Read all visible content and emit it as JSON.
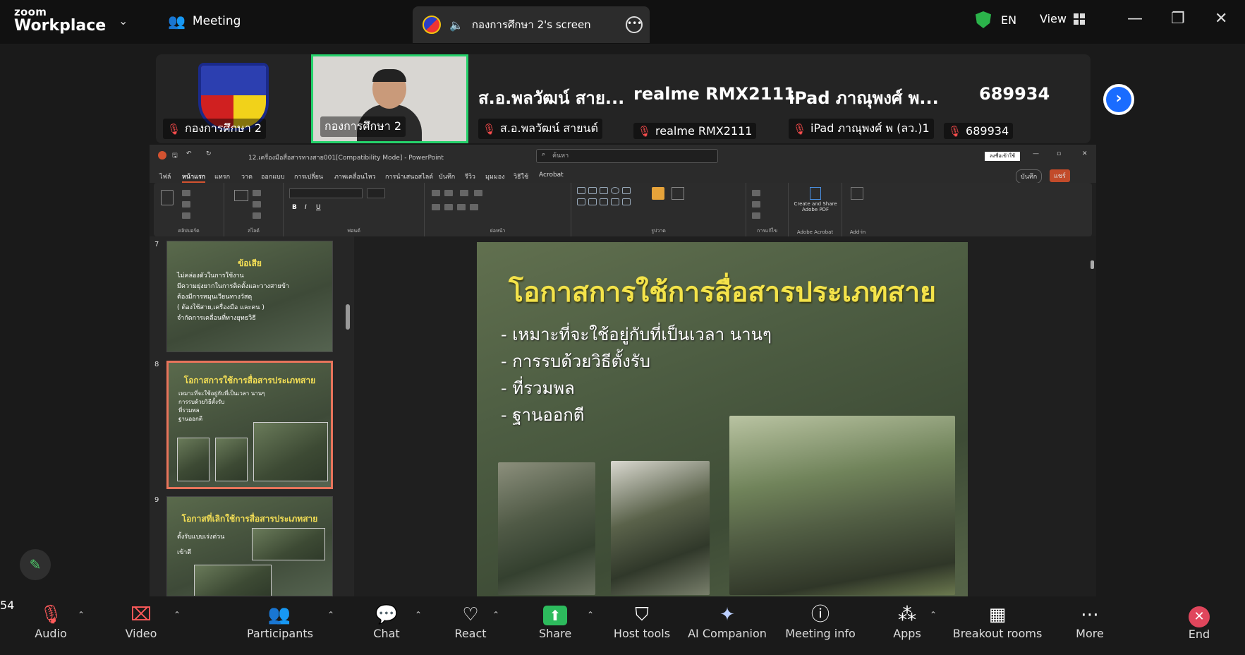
{
  "app": {
    "brand_top": "zoom",
    "brand_bottom": "Workplace"
  },
  "header": {
    "meeting_label": "Meeting",
    "screen_tab_label": "กองการศึกษา 2's screen",
    "language": "EN",
    "view_label": "View"
  },
  "participants": [
    {
      "name": "กองการศึกษา 2",
      "display": "",
      "muted": true
    },
    {
      "name": "กองการศึกษา 2",
      "display": "",
      "muted": false
    },
    {
      "name": "ส.อ.พลวัฒน์ สายนต์",
      "display": "ส.อ.พลวัฒน์ สาย...",
      "muted": true
    },
    {
      "name": "realme RMX2111",
      "display": "realme RMX2111",
      "muted": true
    },
    {
      "name": "iPad ภาณุพงศ์ พ (ลว.)1",
      "display": "iPad ภาณุพงศ์ พ...",
      "muted": true
    },
    {
      "name": "689934",
      "display": "689934",
      "muted": true
    }
  ],
  "powerpoint": {
    "title": "12.เครื่องมือสื่อสารทางสาย001[Compatibility Mode] - PowerPoint",
    "search_placeholder": "ค้นหา",
    "account_btn": "ลงชื่อเข้าใช้",
    "tabs": [
      "ไฟล์",
      "หน้าแรก",
      "แทรก",
      "วาด",
      "ออกแบบ",
      "การเปลี่ยน",
      "ภาพเคลื่อนไหว",
      "การนำเสนอสไลด์",
      "บันทึก",
      "รีวิว",
      "มุมมอง",
      "วิธีใช้",
      "Acrobat"
    ],
    "ribbon": {
      "clipboard": "คลิปบอร์ด",
      "slides": "สไลด์",
      "font": "ฟอนต์",
      "paragraph": "ย่อหน้า",
      "drawing": "รูปวาด",
      "editing": "การแก้ไข",
      "acrobat_btn": "Create and Share Adobe PDF",
      "acrobat": "Adobe Acrobat",
      "addin": "Add-in",
      "record_btn": "บันทึก",
      "share_btn": "แชร์"
    },
    "thumbnails": [
      {
        "num": "7",
        "title": "ข้อเสีย",
        "bullets": [
          "ไม่คล่องตัวในการใช้งาน",
          "มีความยุ่งยากในการติดตั้งและวางสายข้า",
          "ต้องมีการหมุนเวียนทางวัสดุ",
          "( ต้องใช้สาย,เครื่องมือ และคน )",
          "จำกัดการเคลื่อนที่ทางยุทธวิธี"
        ]
      },
      {
        "num": "8",
        "title": "โอกาสการใช้การสื่อสารประเภทสาย",
        "bullets": [
          "เหมาะที่จะใช้อยู่กับที่เป็นเวลา นานๆ",
          "การรบด้วยวิธีตั้งรับ",
          "ที่รวมพล",
          "ฐานออกตี"
        ]
      },
      {
        "num": "9",
        "title": "โอกาสที่เลิกใช้การสื่อสารประเภทสาย",
        "bullets": [
          "ตั้งรับแบบเร่งด่วน",
          "เข้าตี"
        ]
      }
    ],
    "slide": {
      "title": "โอกาสการใช้การสื่อสารประเภทสาย",
      "bullets": [
        "เหมาะที่จะใช้อยู่กับที่เป็นเวลา นานๆ",
        "การรบด้วยวิธีตั้งรับ",
        "ที่รวมพล",
        "ฐานออกตี"
      ]
    }
  },
  "toolbar": {
    "audio": "Audio",
    "video": "Video",
    "participants": "Participants",
    "participant_count": "54",
    "chat": "Chat",
    "react": "React",
    "share": "Share",
    "host_tools": "Host tools",
    "ai_companion": "AI Companion",
    "meeting_info": "Meeting info",
    "apps": "Apps",
    "breakout_rooms": "Breakout rooms",
    "more": "More",
    "end": "End"
  },
  "colors": {
    "accent_green": "#25d16b",
    "share_green": "#2dbb5d",
    "end_red": "#e0465c",
    "ppt_orange": "#d35230",
    "slide_title_yellow": "#f4e34a"
  }
}
